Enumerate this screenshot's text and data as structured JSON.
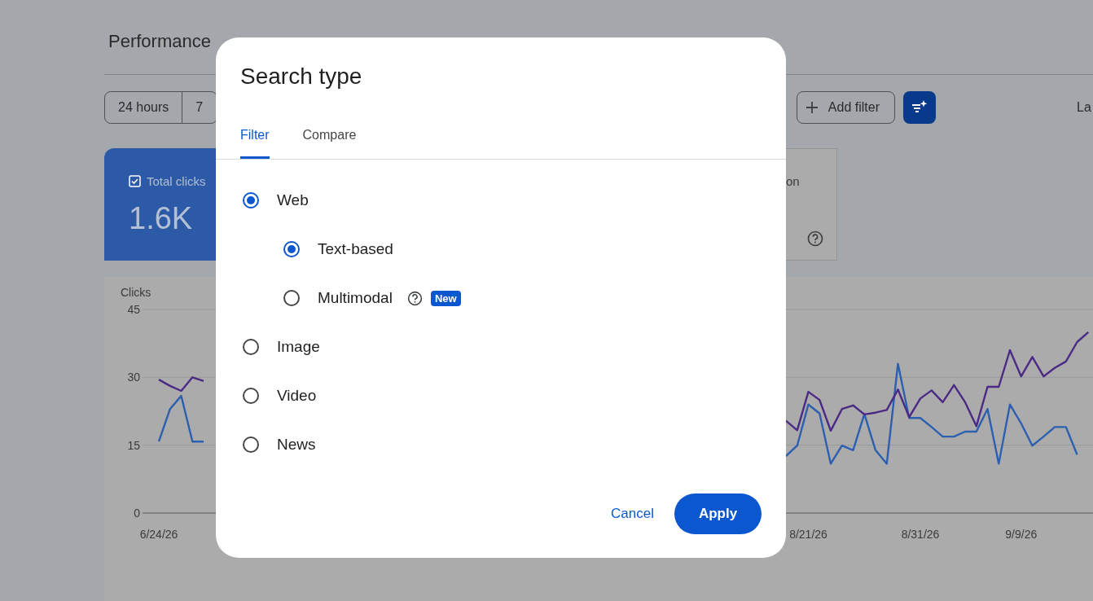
{
  "page": {
    "title": "Performance",
    "range_chips": [
      {
        "label": "24 hours",
        "selected": false
      },
      {
        "label": "7",
        "selected": false
      }
    ],
    "add_filter": "Add filter",
    "right_text": "La"
  },
  "metrics": [
    {
      "label": "Total clicks",
      "value": "1.6K",
      "checked": true
    },
    {
      "label": "on"
    }
  ],
  "chart": {
    "chart_data": {
      "type": "line",
      "ylabel": "Clicks",
      "categories": [
        "6/24/26",
        null,
        null,
        null,
        null,
        null,
        null,
        null,
        null,
        null,
        null,
        null,
        null,
        null,
        null,
        null,
        null,
        null,
        null,
        null,
        null,
        null,
        null,
        null,
        null,
        null,
        null,
        null,
        null,
        null,
        null,
        null,
        null,
        null,
        null,
        null,
        null,
        null,
        null,
        null,
        null,
        null,
        null,
        null,
        null,
        null,
        null,
        null,
        null,
        null,
        null,
        null,
        null,
        null,
        null,
        null,
        null,
        null,
        "8/21/26",
        null,
        null,
        null,
        null,
        null,
        null,
        null,
        null,
        null,
        "8/31/26",
        null,
        null,
        null,
        null,
        null,
        null,
        null,
        null,
        "9/9/26",
        null,
        null,
        null,
        null,
        null,
        null
      ],
      "ylim": [
        0,
        45
      ],
      "yticks": [
        0,
        15,
        30,
        45
      ],
      "series": [
        {
          "color": "#2d5fb0",
          "values": [
            15.8,
            23,
            25.9,
            15.8,
            15.8,
            null,
            null,
            null,
            null,
            null,
            null,
            null,
            null,
            null,
            null,
            null,
            null,
            null,
            null,
            null,
            null,
            null,
            null,
            null,
            null,
            null,
            null,
            null,
            null,
            null,
            null,
            null,
            null,
            null,
            null,
            null,
            null,
            null,
            null,
            null,
            null,
            null,
            null,
            null,
            null,
            null,
            null,
            null,
            null,
            null,
            null,
            null,
            null,
            null,
            null,
            null,
            12.6,
            14.9,
            24,
            22,
            10.9,
            14.9,
            13.9,
            21.9,
            13.9,
            10.9,
            33,
            21,
            21,
            19,
            16.9,
            16.9,
            18,
            18,
            23,
            10.9,
            24,
            19.8,
            14.9,
            16.9,
            19,
            19,
            12.9,
            null
          ]
        },
        {
          "color": "#4b2a85",
          "values": [
            29.5,
            28.1,
            27,
            30,
            29.2,
            null,
            null,
            null,
            null,
            null,
            null,
            null,
            null,
            null,
            null,
            null,
            null,
            null,
            null,
            null,
            null,
            null,
            null,
            null,
            null,
            null,
            null,
            null,
            null,
            null,
            null,
            null,
            null,
            null,
            null,
            null,
            null,
            null,
            null,
            null,
            null,
            null,
            null,
            null,
            null,
            null,
            null,
            null,
            null,
            null,
            null,
            null,
            null,
            null,
            null,
            null,
            20.4,
            18.3,
            26.8,
            25,
            18.2,
            23,
            23.8,
            21.8,
            22.2,
            22.8,
            27.3,
            21.2,
            25.3,
            27.1,
            24.5,
            28.3,
            24.5,
            19.2,
            27.9,
            27.9,
            36,
            30.2,
            34.5,
            30.2,
            32.1,
            33.5,
            37.8,
            40
          ]
        }
      ]
    }
  },
  "dialog": {
    "title": "Search type",
    "tabs": [
      {
        "label": "Filter",
        "selected": true
      },
      {
        "label": "Compare",
        "selected": false
      }
    ],
    "options": [
      {
        "label": "Web",
        "selected": true,
        "children": [
          {
            "label": "Text-based",
            "selected": true
          },
          {
            "label": "Multimodal",
            "selected": false,
            "help": true,
            "badge": "New"
          }
        ]
      },
      {
        "label": "Image",
        "selected": false
      },
      {
        "label": "Video",
        "selected": false
      },
      {
        "label": "News",
        "selected": false
      }
    ],
    "buttons": [
      {
        "label": "Cancel",
        "kind": "text"
      },
      {
        "label": "Apply",
        "kind": "filled"
      }
    ]
  }
}
